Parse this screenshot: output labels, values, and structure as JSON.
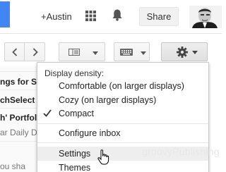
{
  "header": {
    "user_link": "+Austin",
    "share_label": "Share",
    "icons": [
      "apps-grid-icon",
      "notifications-bell-icon",
      "profile-avatar"
    ]
  },
  "toolbar": {
    "icons": [
      "chevron-left-icon",
      "chevron-right-icon",
      "split-pane-view-icon",
      "keyboard-icon",
      "gear-icon"
    ]
  },
  "list": {
    "items": [
      {
        "text": "ngs for Sch",
        "style": "bold"
      },
      {
        "text": "chSelect",
        "style": "bold"
      },
      {
        "text": "h' Portfol",
        "style": "bold"
      },
      {
        "text": "ar Daily Di",
        "style": "muted"
      },
      {
        "text": "ou sha",
        "style": "muted"
      }
    ]
  },
  "menu": {
    "header": "Display density:",
    "density_options": [
      {
        "label": "Comfortable (on larger displays)",
        "checked": false
      },
      {
        "label": "Cozy (on larger displays)",
        "checked": false
      },
      {
        "label": "Compact",
        "checked": true
      }
    ],
    "configure_inbox": "Configure inbox",
    "settings": "Settings",
    "themes": "Themes",
    "watermark": "groovyPublishing"
  },
  "colors": {
    "accent_blue": "#4285f4",
    "menu_hover": "#eeeeee"
  }
}
